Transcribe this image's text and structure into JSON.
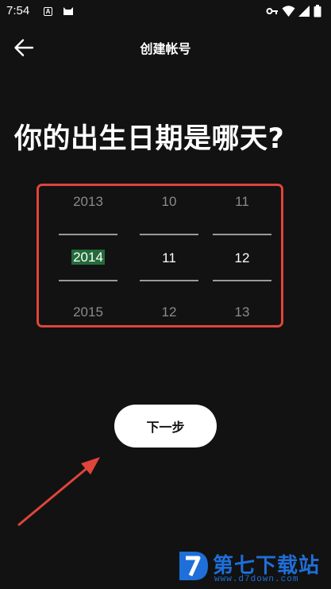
{
  "status_bar": {
    "time": "7:54",
    "notification_letter": "A",
    "icons": [
      "cat-notification-icon",
      "key-icon",
      "wifi-icon",
      "cellular-signal-icon",
      "battery-icon"
    ]
  },
  "header": {
    "back_icon": "arrow-left-icon",
    "title": "创建帐号"
  },
  "question": "你的出生日期是哪天?",
  "date_picker": {
    "year": {
      "prev": "2013",
      "selected": "2014",
      "next": "2015"
    },
    "month": {
      "prev": "10",
      "selected": "11",
      "next": "12"
    },
    "day": {
      "prev": "11",
      "selected": "12",
      "next": "13"
    }
  },
  "next_button": {
    "label": "下一步"
  },
  "watermark": {
    "text": "第七下载站",
    "url": "www.d7down.com"
  },
  "colors": {
    "background": "#121212",
    "annotation": "#e0443a",
    "button_bg": "#ffffff",
    "selection_highlight": "#236b3a",
    "watermark": "#1e6fd9"
  }
}
